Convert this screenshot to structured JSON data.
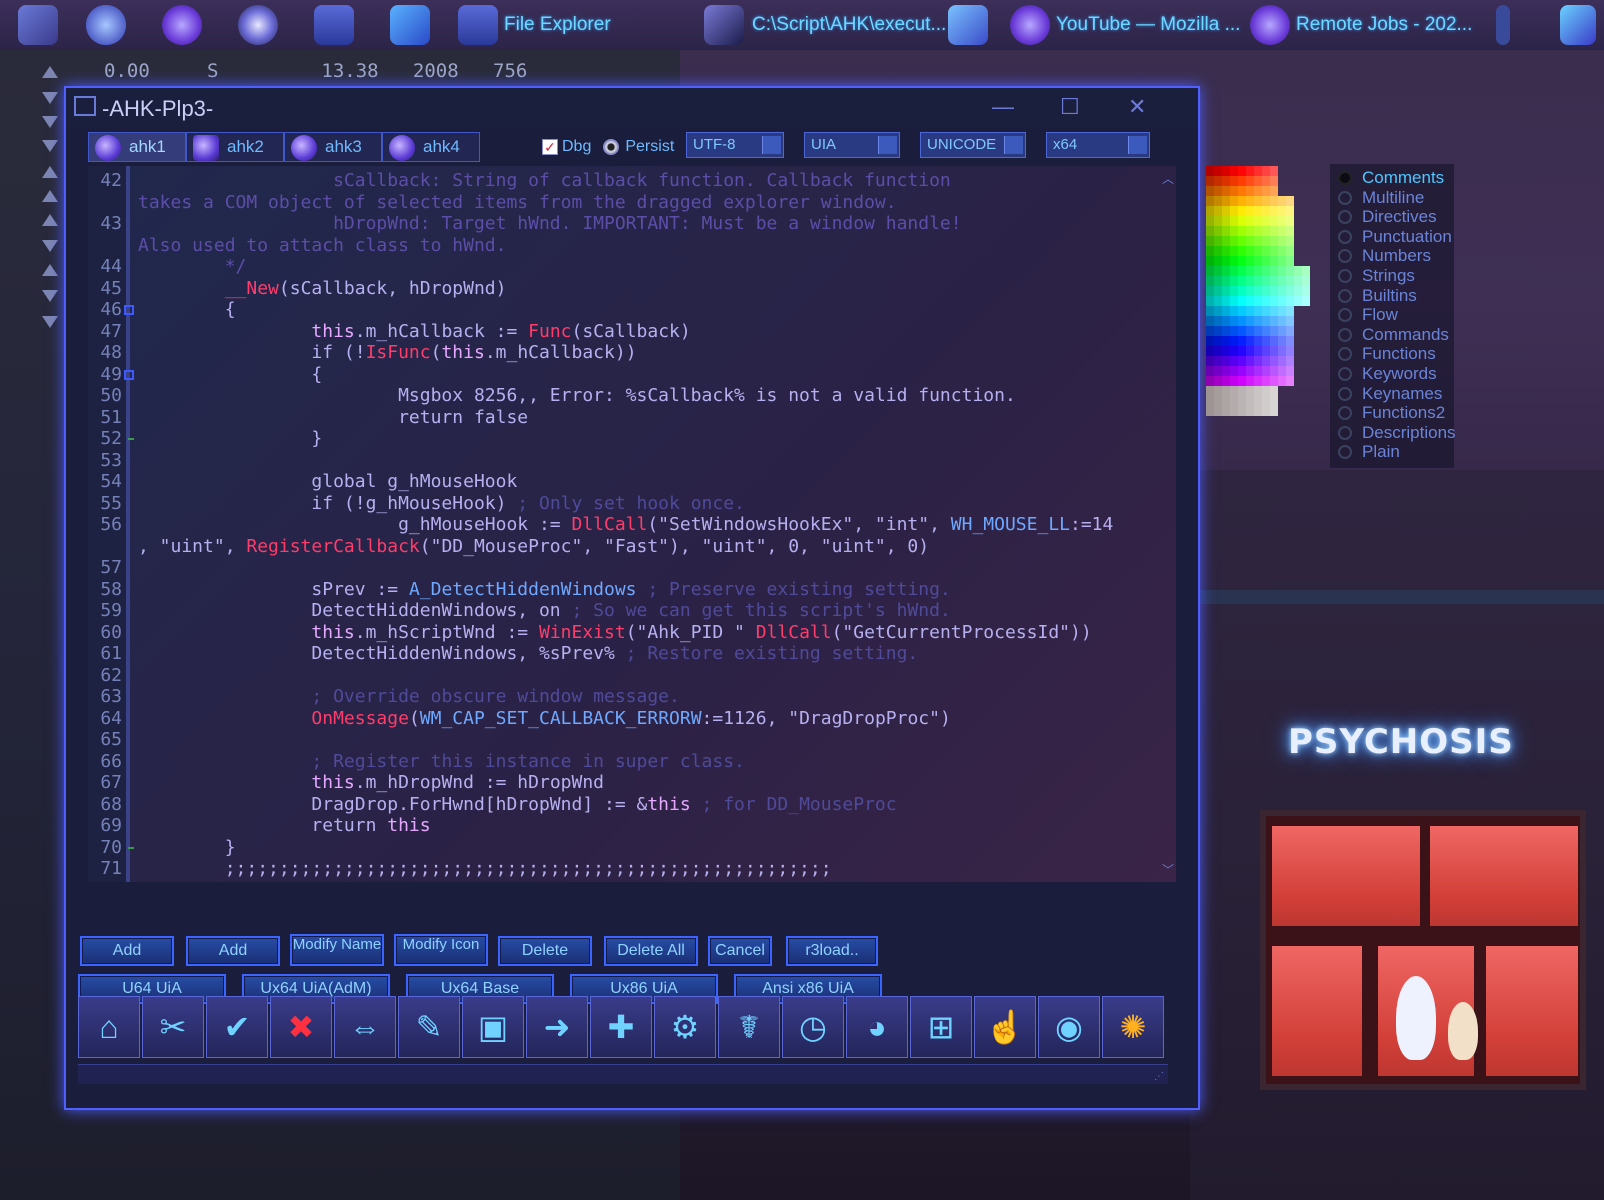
{
  "taskbar": {
    "items": [
      {
        "name": "start-icon",
        "label": ""
      },
      {
        "name": "bird-app-icon",
        "label": ""
      },
      {
        "name": "firefox-icon",
        "label": ""
      },
      {
        "name": "orb-app-icon",
        "label": ""
      },
      {
        "name": "folder-icon",
        "label": ""
      },
      {
        "name": "vscode-icon",
        "label": ""
      },
      {
        "name": "file-explorer-task",
        "label": "File Explorer"
      },
      {
        "name": "ahk-script-task",
        "label": "C:\\Script\\AHK\\execut..."
      },
      {
        "name": "media-player-icon",
        "label": ""
      },
      {
        "name": "youtube-task",
        "label": "YouTube — Mozilla ..."
      },
      {
        "name": "remote-jobs-task",
        "label": "Remote Jobs - 202..."
      }
    ]
  },
  "stats": {
    "a": "0.00",
    "b": "S",
    "c": "13.38",
    "d": "2008",
    "e": "756"
  },
  "window": {
    "title": "-AHK-Plp3-",
    "tabs": [
      "ahk1",
      "ahk2",
      "ahk3",
      "ahk4"
    ],
    "options": {
      "dbg": "Dbg",
      "persist": "Persist"
    },
    "dropdowns": {
      "encoding": "UTF-8",
      "mode": "UIA",
      "charset": "UNICODE",
      "arch": "x64"
    }
  },
  "code": {
    "lines": [
      {
        "n": "42",
        "html": "",
        "text": "                  sCallback: String of callback function. Callback function"
      },
      {
        "n": "",
        "text": "takes a COM object of selected items from the dragged explorer window."
      },
      {
        "n": "43",
        "text": "                  hDropWnd: Target hWnd. IMPORTANT: Must be a window handle!"
      },
      {
        "n": "",
        "text": "Also used to attach class to hWnd."
      },
      {
        "n": "44",
        "text": "        */"
      },
      {
        "n": "45",
        "text": "        __New(sCallback, hDropWnd)"
      },
      {
        "n": "46",
        "text": "        {"
      },
      {
        "n": "47",
        "text": "                this.m_hCallback := Func(sCallback)"
      },
      {
        "n": "48",
        "text": "                if (!IsFunc(this.m_hCallback))"
      },
      {
        "n": "49",
        "text": "                {"
      },
      {
        "n": "50",
        "text": "                        Msgbox 8256,, Error: %sCallback% is not a valid function."
      },
      {
        "n": "51",
        "text": "                        return false"
      },
      {
        "n": "52",
        "text": "                }"
      },
      {
        "n": "53",
        "text": ""
      },
      {
        "n": "54",
        "text": "                global g_hMouseHook"
      },
      {
        "n": "55",
        "text": "                if (!g_hMouseHook) ; Only set hook once."
      },
      {
        "n": "56",
        "text": "                        g_hMouseHook := DllCall(\"SetWindowsHookEx\", \"int\", WH_MOUSE_LL:=14"
      },
      {
        "n": "",
        "text": ", \"uint\", RegisterCallback(\"DD_MouseProc\", \"Fast\"), \"uint\", 0, \"uint\", 0)"
      },
      {
        "n": "57",
        "text": ""
      },
      {
        "n": "58",
        "text": "                sPrev := A_DetectHiddenWindows ; Preserve existing setting."
      },
      {
        "n": "59",
        "text": "                DetectHiddenWindows, on ; So we can get this script's hWnd."
      },
      {
        "n": "60",
        "text": "                this.m_hScriptWnd := WinExist(\"Ahk_PID \" DllCall(\"GetCurrentProcessId\"))"
      },
      {
        "n": "61",
        "text": "                DetectHiddenWindows, %sPrev% ; Restore existing setting."
      },
      {
        "n": "62",
        "text": ""
      },
      {
        "n": "63",
        "text": "                ; Override obscure window message."
      },
      {
        "n": "64",
        "text": "                OnMessage(WM_CAP_SET_CALLBACK_ERRORW:=1126, \"DragDropProc\")"
      },
      {
        "n": "65",
        "text": ""
      },
      {
        "n": "66",
        "text": "                ; Register this instance in super class."
      },
      {
        "n": "67",
        "text": "                this.m_hDropWnd := hDropWnd"
      },
      {
        "n": "68",
        "text": "                DragDrop.ForHwnd[hDropWnd] := &this ; for DD_MouseProc"
      },
      {
        "n": "69",
        "text": "                return this"
      },
      {
        "n": "70",
        "text": "        }"
      },
      {
        "n": "71",
        "text": "        ;;;;;;;;;;;;;;;;;;;;;;;;;;;;;;;;;;;;;;;;;;;;;;;;;;;;;;;;"
      }
    ]
  },
  "categories": [
    "Comments",
    "Multiline",
    "Directives",
    "Punctuation",
    "Numbers",
    "Strings",
    "Builtins",
    "Flow",
    "Commands",
    "Functions",
    "Keywords",
    "Keynames",
    "Functions2",
    "Descriptions",
    "Plain"
  ],
  "buttons": {
    "row1": [
      "Add",
      "Add",
      "Modify Name",
      "Modify Icon",
      "Delete",
      "Delete All",
      "Cancel",
      "r3load.."
    ],
    "row2": [
      "U64 UiA",
      "Ux64 UiA(AdM)",
      "Ux64 Base",
      "Ux86 UiA",
      "Ansi x86 UiA"
    ]
  },
  "iconbar": [
    "home-icon",
    "scissors-tool-icon",
    "check-icon",
    "close-icon",
    "transfer-icon",
    "paint-tool-icon",
    "save-disk-icon",
    "send-window-icon",
    "syringe-icon",
    "laptop-settings-icon",
    "dna-icon",
    "clock-globe-icon",
    "shield-pie-icon",
    "windows-logo-icon",
    "hand-pointer-icon",
    "ahk-orb-icon",
    "color-wheel-icon"
  ],
  "neon_sign": "PSYCHOSIS",
  "colors": {
    "accent": "#4d5cff",
    "keyword": "#ff3c6a",
    "comment": "#4f4a9a",
    "highlight": "#4fc6ff"
  }
}
